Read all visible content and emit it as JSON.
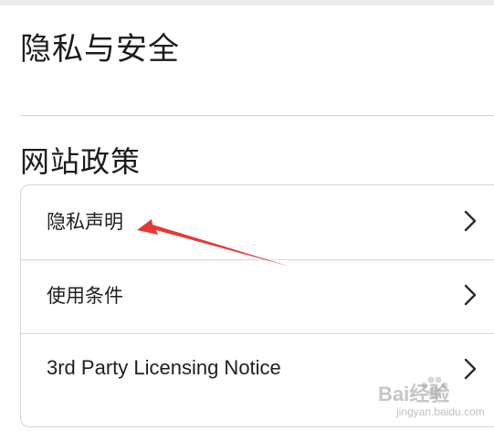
{
  "page": {
    "title": "隐私与安全"
  },
  "section": {
    "title": "网站政策",
    "items": [
      {
        "label": "隐私声明"
      },
      {
        "label": "使用条件"
      },
      {
        "label": "3rd Party Licensing Notice"
      }
    ]
  },
  "annotation": {
    "arrow_color": "#e53935"
  },
  "watermark": {
    "brand": "Bai经验",
    "site": "jingyan.baidu.com"
  },
  "icons": {
    "row_chevron": "chevron-right-icon"
  }
}
